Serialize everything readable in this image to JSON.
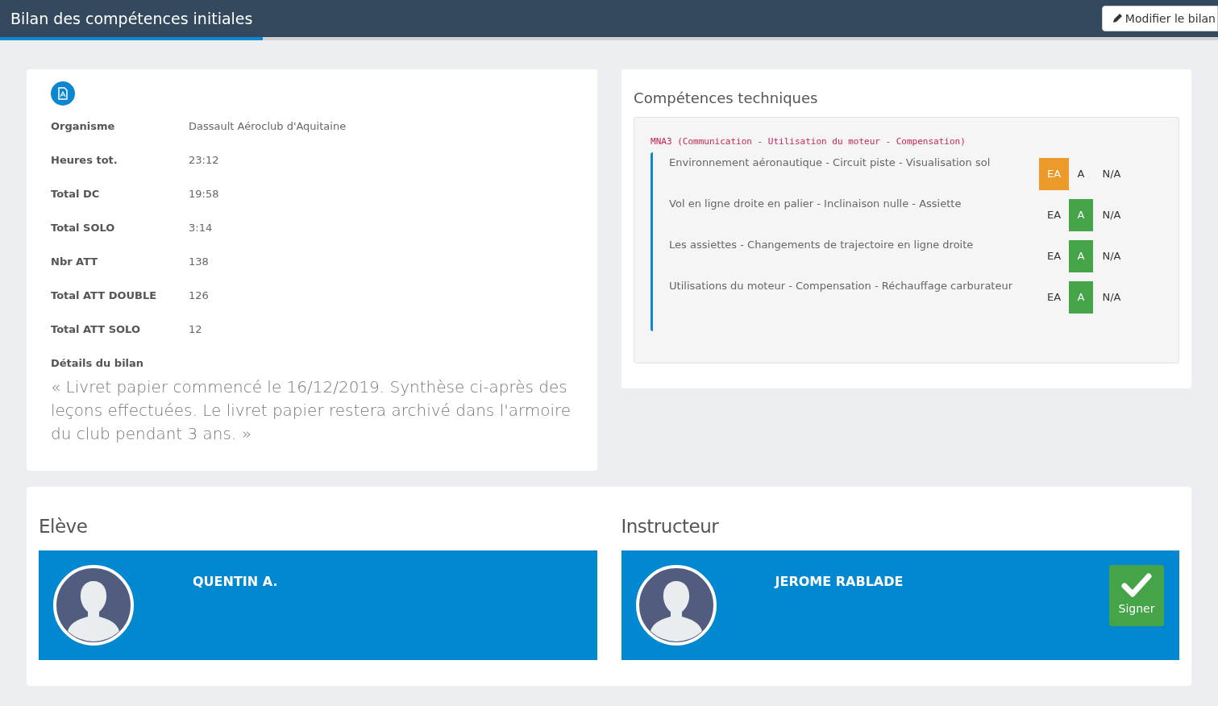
{
  "header": {
    "title": "Bilan des compétences initiales",
    "edit_button": "Modifier le bilan"
  },
  "summary": {
    "fields": [
      {
        "label": "Organisme",
        "value": "Dassault Aéroclub d'Aquitaine"
      },
      {
        "label": "Heures tot.",
        "value": "23:12"
      },
      {
        "label": "Total DC",
        "value": "19:58"
      },
      {
        "label": "Total SOLO",
        "value": "3:14"
      },
      {
        "label": "Nbr ATT",
        "value": "138"
      },
      {
        "label": "Total ATT DOUBLE",
        "value": "126"
      },
      {
        "label": "Total ATT SOLO",
        "value": "12"
      }
    ],
    "details_label": "Détails du bilan",
    "details_text": "« Livret papier commencé le 16/12/2019. Synthèse ci-après des leçons effectuées. Le livret papier restera archivé dans l'armoire du club pendant 3 ans. »"
  },
  "skills": {
    "title": "Compétences techniques",
    "group": "MNA3 (Communication - Utilisation du moteur - Compensation)",
    "items": [
      {
        "name": "Environnement aéronautique - Circuit piste - Visualisation sol",
        "options": [
          {
            "label": "EA",
            "kind": "ea",
            "selected": true
          },
          {
            "label": "A",
            "kind": "a",
            "selected": false
          },
          {
            "label": "N/A",
            "kind": "na",
            "selected": false
          }
        ]
      },
      {
        "name": "Vol en ligne droite en palier - Inclinaison nulle - Assiette",
        "options": [
          {
            "label": "EA",
            "kind": "ea",
            "selected": false
          },
          {
            "label": "A",
            "kind": "a",
            "selected": true
          },
          {
            "label": "N/A",
            "kind": "na",
            "selected": false
          }
        ]
      },
      {
        "name": "Les assiettes - Changements de trajectoire en ligne droite",
        "options": [
          {
            "label": "EA",
            "kind": "ea",
            "selected": false
          },
          {
            "label": "A",
            "kind": "a",
            "selected": true
          },
          {
            "label": "N/A",
            "kind": "na",
            "selected": false
          }
        ]
      },
      {
        "name": "Utilisations du moteur - Compensation - Réchauffage carburateur",
        "options": [
          {
            "label": "EA",
            "kind": "ea",
            "selected": false
          },
          {
            "label": "A",
            "kind": "a",
            "selected": true
          },
          {
            "label": "N/A",
            "kind": "na",
            "selected": false
          }
        ]
      }
    ]
  },
  "signatures": [
    {
      "role": "Elève",
      "name": "QUENTIN A."
    },
    {
      "role": "Instructeur",
      "name": "JEROME RABLADE",
      "sign_button": "Signer"
    }
  ]
}
